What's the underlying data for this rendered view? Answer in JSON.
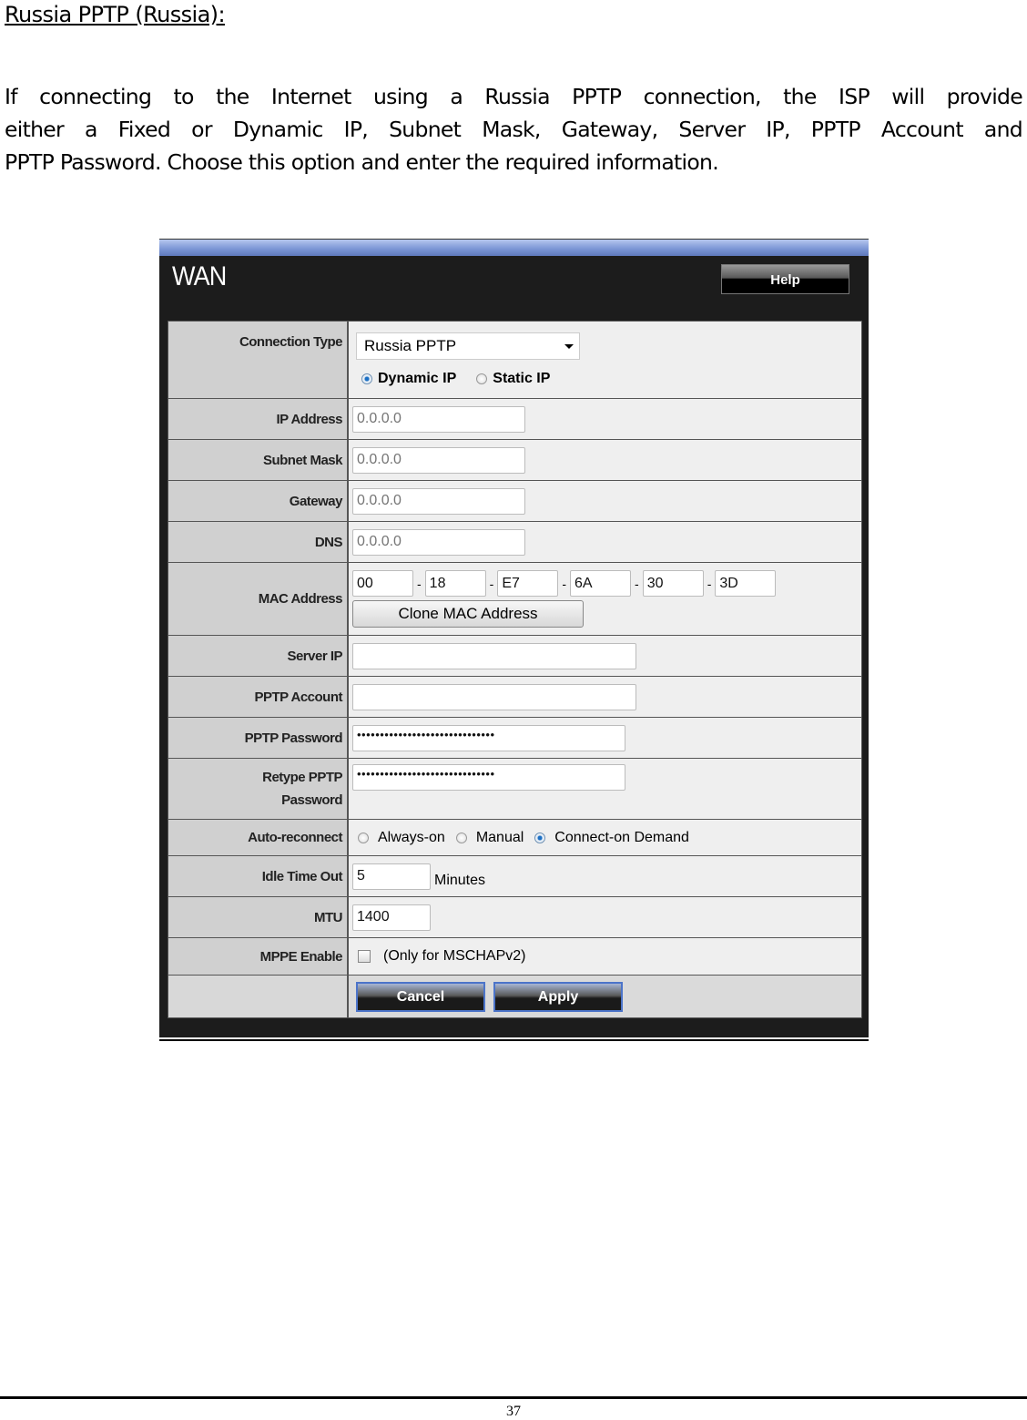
{
  "document": {
    "heading": "Russia PPTP (Russia):",
    "paragraph_lines": [
      "If connecting to the Internet using a Russia PPTP connection, the ISP will provide",
      "either a Fixed or Dynamic IP, Subnet Mask, Gateway, Server IP, PPTP Account and",
      "PPTP Password. Choose this option and enter the required information."
    ],
    "page_number": "37"
  },
  "wan": {
    "title": "WAN",
    "help_label": "Help",
    "connection_type": {
      "label": "Connection Type",
      "selected": "Russia PPTP",
      "ip_modes": [
        {
          "label": "Dynamic IP",
          "selected": true
        },
        {
          "label": "Static IP",
          "selected": false
        }
      ]
    },
    "ip_address": {
      "label": "IP Address",
      "placeholder": "0.0.0.0"
    },
    "subnet_mask": {
      "label": "Subnet Mask",
      "placeholder": "0.0.0.0"
    },
    "gateway": {
      "label": "Gateway",
      "placeholder": "0.0.0.0"
    },
    "dns": {
      "label": "DNS",
      "placeholder": "0.0.0.0"
    },
    "mac_address": {
      "label": "MAC Address",
      "octets": [
        "00",
        "18",
        "E7",
        "6A",
        "30",
        "3D"
      ],
      "separator": "-",
      "clone_label": "Clone MAC Address"
    },
    "server_ip": {
      "label": "Server IP",
      "value": ""
    },
    "pptp_account": {
      "label": "PPTP Account",
      "value": ""
    },
    "pptp_password": {
      "label": "PPTP Password",
      "masked": "••••••••••••••••••••••••••••••"
    },
    "retype_password": {
      "label_line1": "Retype PPTP",
      "label_line2": "Password",
      "masked": "••••••••••••••••••••••••••••••"
    },
    "auto_reconnect": {
      "label": "Auto-reconnect",
      "options": [
        {
          "label": "Always-on",
          "selected": false
        },
        {
          "label": "Manual",
          "selected": false
        },
        {
          "label": "Connect-on Demand",
          "selected": true
        }
      ]
    },
    "idle_timeout": {
      "label": "Idle Time Out",
      "value": "5",
      "unit": "Minutes"
    },
    "mtu": {
      "label": "MTU",
      "value": "1400"
    },
    "mppe": {
      "label": "MPPE Enable",
      "checked": false,
      "note": "(Only for MSCHAPv2)"
    },
    "cancel_label": "Cancel",
    "apply_label": "Apply"
  }
}
